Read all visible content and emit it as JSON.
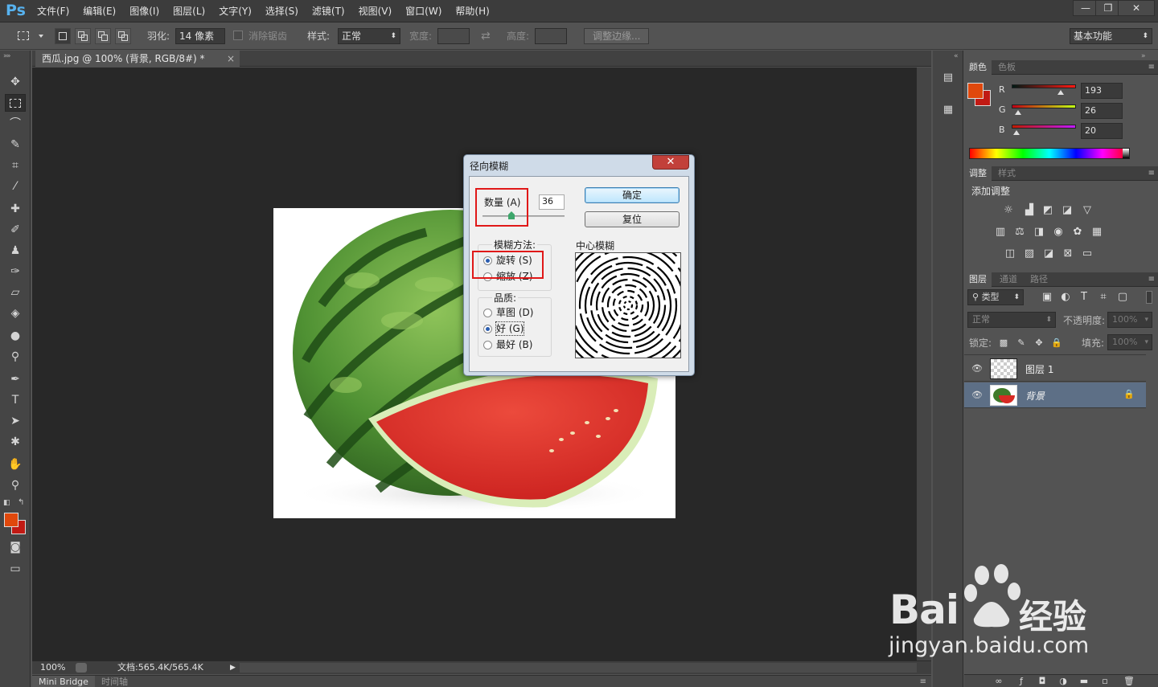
{
  "app": {
    "logo": "Ps",
    "menu": [
      "文件(F)",
      "编辑(E)",
      "图像(I)",
      "图层(L)",
      "文字(Y)",
      "选择(S)",
      "滤镜(T)",
      "视图(V)",
      "窗口(W)",
      "帮助(H)"
    ],
    "window_buttons": [
      "—",
      "❐",
      "✕"
    ]
  },
  "options": {
    "feather_label": "羽化:",
    "feather_value": "14 像素",
    "antialias_label": "消除锯齿",
    "style_label": "样式:",
    "style_value": "正常",
    "width_label": "宽度:",
    "height_label": "高度:",
    "refine_edge": "调整边缘...",
    "workspace": "基本功能"
  },
  "document": {
    "tab_title": "西瓜.jpg @ 100% (背景, RGB/8#) *",
    "tab_close": "×",
    "zoom": "100%",
    "doc_size": "文档:565.4K/565.4K",
    "bottom_tabs": [
      "Mini Bridge",
      "时间轴"
    ]
  },
  "dialog": {
    "title": "径向模糊",
    "close": "✕",
    "amount_label": "数量 (A)",
    "amount_value": "36",
    "ok": "确定",
    "reset": "复位",
    "method_label": "模糊方法:",
    "method_options": [
      "旋转 (S)",
      "缩放 (Z)"
    ],
    "method_selected": "旋转 (S)",
    "quality_label": "品质:",
    "quality_options": [
      "草图 (D)",
      "好 (G)",
      "最好 (B)"
    ],
    "quality_selected": "好 (G)",
    "center_label": "中心模糊"
  },
  "color_panel": {
    "tabs": [
      "颜色",
      "色板"
    ],
    "channels": [
      {
        "name": "R",
        "value": "193",
        "fraction": 0.757
      },
      {
        "name": "G",
        "value": "26",
        "fraction": 0.102
      },
      {
        "name": "B",
        "value": "20",
        "fraction": 0.078
      }
    ],
    "foreground": "#c11a14",
    "background": "#e0310c"
  },
  "adjust_panel": {
    "tabs": [
      "调整",
      "样式"
    ],
    "title": "添加调整"
  },
  "layers_panel": {
    "tabs": [
      "图层",
      "通道",
      "路径"
    ],
    "filter_kind": "类型",
    "blend_mode": "正常",
    "opacity_label": "不透明度:",
    "opacity_value": "100%",
    "lock_label": "锁定:",
    "fill_label": "填充:",
    "fill_value": "100%",
    "layers": [
      {
        "name": "图层 1",
        "selected": false
      },
      {
        "name": "背景",
        "selected": true
      }
    ]
  },
  "watermark": {
    "brand": "Bai",
    "brand2": "经验",
    "url": "jingyan.baidu.com"
  }
}
